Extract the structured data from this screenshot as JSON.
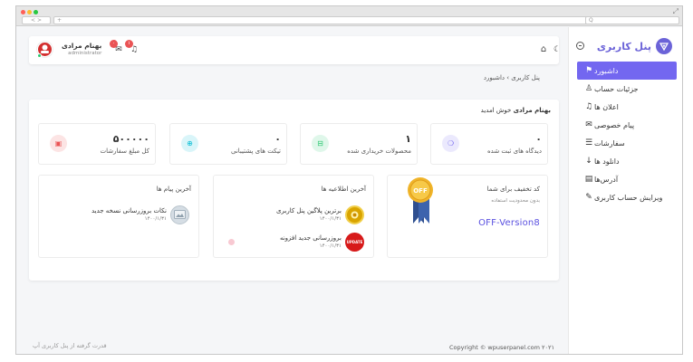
{
  "browser": {
    "nav_label": "< >",
    "address_text": "+",
    "search_text": "Q",
    "expand_glyph": "⤢",
    "dot_colors": [
      "#ff5f57",
      "#febc2e",
      "#28c840"
    ]
  },
  "sidebar": {
    "brand_name": "پنل کاربری",
    "accent": "#7367f0",
    "items": [
      {
        "label": "داشبورد",
        "icon": "flag-icon",
        "glyph": "⚑",
        "active": true
      },
      {
        "label": "جزئیات حساب",
        "icon": "user-icon",
        "glyph": "♙",
        "active": false
      },
      {
        "label": "اعلان ها",
        "icon": "bell-icon",
        "glyph": "♫",
        "active": false
      },
      {
        "label": "پیام خصوصی",
        "icon": "mail-icon",
        "glyph": "✉",
        "active": false
      },
      {
        "label": "سفارشات",
        "icon": "list-icon",
        "glyph": "☰",
        "active": false
      },
      {
        "label": "دانلود ها",
        "icon": "download-icon",
        "glyph": "↓",
        "active": false
      },
      {
        "label": "آدرس‌ها",
        "icon": "address-card-icon",
        "glyph": "▤",
        "active": false
      },
      {
        "label": "ویرایش حساب کاربری",
        "icon": "edit-icon",
        "glyph": "✎",
        "active": false
      }
    ]
  },
  "topbar": {
    "user_name": "بهنام مرادی",
    "user_role": "administrator",
    "mail_badge": "۰",
    "bell_badge": "۱",
    "home_glyph": "⌂",
    "theme_glyph": "☾",
    "mail_glyph": "✉",
    "bell_glyph": "♫"
  },
  "breadcrumb": "پنل کاربری  ›  داشبورد",
  "welcome": {
    "name": "بهنام مرادی",
    "text": "خوش امدید"
  },
  "stats": [
    {
      "value": "۰",
      "label": "دیدگاه های ثبت شده",
      "icon": "comments-icon",
      "glyph": "❍",
      "color": "#7367f0",
      "bg": "#ebe9fd"
    },
    {
      "value": "۱",
      "label": "محصولات خریداری شده",
      "icon": "basket-icon",
      "glyph": "⊟",
      "color": "#28c76f",
      "bg": "#dff7ea"
    },
    {
      "value": "۰",
      "label": "تیکت های پشتیبانی",
      "icon": "support-icon",
      "glyph": "⊕",
      "color": "#00bcd4",
      "bg": "#d9f5f9"
    },
    {
      "value": "۵۰۰۰۰۰",
      "label": "کل مبلغ سفارشات",
      "icon": "money-icon",
      "glyph": "▣",
      "color": "#ea5455",
      "bg": "#fce4e4"
    }
  ],
  "discount": {
    "title": "کد تخفیف برای شما",
    "subtitle": "بدون محدودیت استفاده",
    "code": "OFF-Version8",
    "ribbon_text": "OFF"
  },
  "announcements": {
    "title": "آخرین اطلاعیه ها",
    "items": [
      {
        "title": "برترین پلاگین پنل کاربری",
        "date": "۱۴۰۰/۱/۳۱",
        "icon": "award-badge-icon"
      },
      {
        "title": "بروزرسانی جدید افزونه",
        "date": "۱۴۰۰/۱/۳۱",
        "icon": "update-badge-icon",
        "icon_text": "UPDATE"
      }
    ]
  },
  "messages": {
    "title": "آخرین پیام ها",
    "items": [
      {
        "title": "نکات بروزرسانی نسخه جدید",
        "date": "۱۴۰۰/۱/۳۱",
        "icon": "message-image-icon"
      }
    ]
  },
  "footer": {
    "left": "قدرت گرفته از پنل کاربری آپ",
    "right": "Copyright © wpuserpanel.com ۲۰۲۱"
  }
}
